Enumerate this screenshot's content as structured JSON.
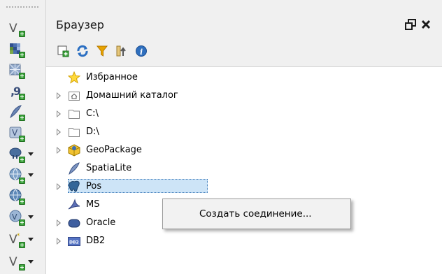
{
  "panel": {
    "title": "Браузер",
    "float_label": "❐",
    "close_label": "✕"
  },
  "toolbar_icons": [
    "add-selected-layers-icon",
    "refresh-icon",
    "filter-icon",
    "collapse-all-icon",
    "info-icon"
  ],
  "left_tools": [
    "add-vector-layer-icon",
    "add-raster-layer-icon",
    "add-mesh-layer-icon",
    "add-delimited-text-layer-icon",
    "add-spatialite-layer-icon",
    "add-virtual-layer-icon",
    "add-postgis-layer-icon",
    "add-wms-layer-icon",
    "add-wfs-layer-icon",
    "add-wcs-layer-icon",
    "new-vector-layer-icon"
  ],
  "tree": {
    "items": [
      {
        "label": "Избранное",
        "expandable": false,
        "icon": "star-icon"
      },
      {
        "label": "Домашний каталог",
        "expandable": true,
        "icon": "home-folder-icon"
      },
      {
        "label": "C:\\",
        "expandable": true,
        "icon": "folder-icon"
      },
      {
        "label": "D:\\",
        "expandable": true,
        "icon": "folder-icon"
      },
      {
        "label": "GeoPackage",
        "expandable": true,
        "icon": "geopackage-icon"
      },
      {
        "label": "SpatiaLite",
        "expandable": false,
        "icon": "spatialite-feather-icon"
      },
      {
        "label": "Pos",
        "expandable": true,
        "icon": "postgresql-elephant-icon"
      },
      {
        "label": "MS",
        "expandable": false,
        "icon": "mssql-icon"
      },
      {
        "label": "Oracle",
        "expandable": true,
        "icon": "oracle-icon"
      },
      {
        "label": "DB2",
        "expandable": true,
        "icon": "db2-icon",
        "badge": "DB2"
      }
    ]
  },
  "context_menu": {
    "items": [
      {
        "label": "Создать соединение..."
      }
    ]
  },
  "colors": {
    "background": "#f0f0f0",
    "tree_background": "#ffffff",
    "selection": "#cde4f7",
    "selection_border": "#3d7ab8",
    "menu_background": "#f2f2f2"
  }
}
